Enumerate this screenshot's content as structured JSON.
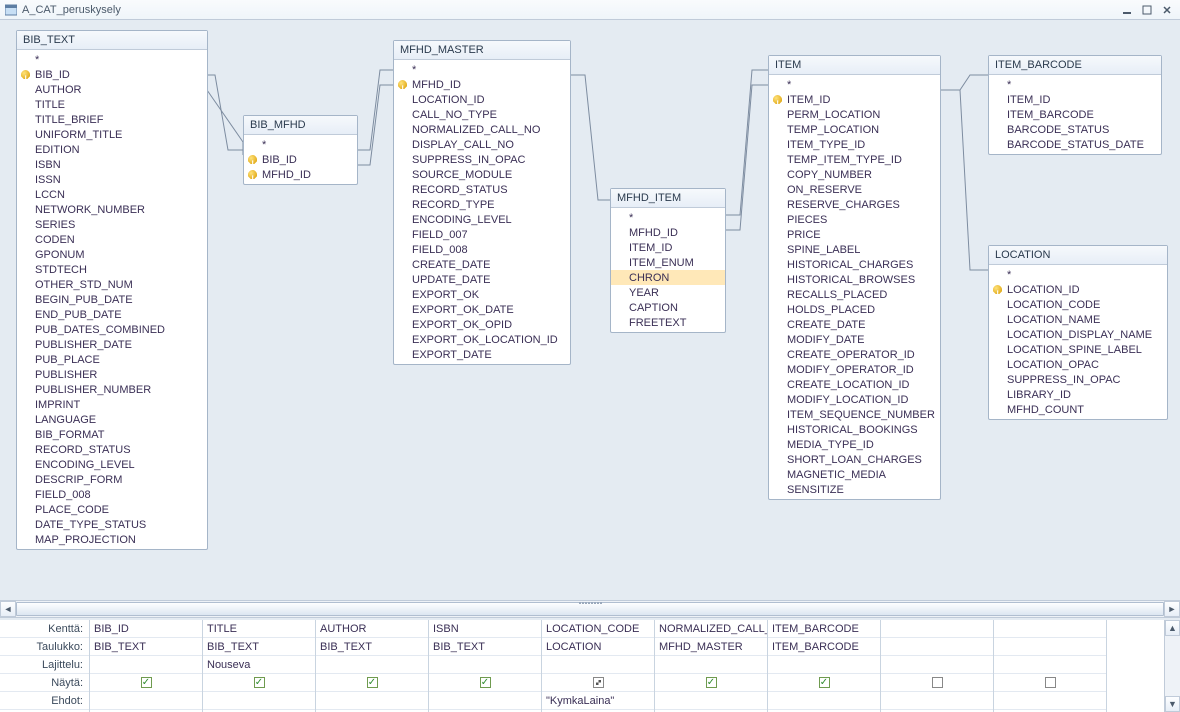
{
  "window": {
    "title": "A_CAT_peruskysely"
  },
  "tables": {
    "bib_text": {
      "title": "BIB_TEXT",
      "fields": [
        "*",
        "BIB_ID",
        "AUTHOR",
        "TITLE",
        "TITLE_BRIEF",
        "UNIFORM_TITLE",
        "EDITION",
        "ISBN",
        "ISSN",
        "LCCN",
        "NETWORK_NUMBER",
        "SERIES",
        "CODEN",
        "GPONUM",
        "STDTECH",
        "OTHER_STD_NUM",
        "BEGIN_PUB_DATE",
        "END_PUB_DATE",
        "PUB_DATES_COMBINED",
        "PUBLISHER_DATE",
        "PUB_PLACE",
        "PUBLISHER",
        "PUBLISHER_NUMBER",
        "IMPRINT",
        "LANGUAGE",
        "BIB_FORMAT",
        "RECORD_STATUS",
        "ENCODING_LEVEL",
        "DESCRIP_FORM",
        "FIELD_008",
        "PLACE_CODE",
        "DATE_TYPE_STATUS",
        "MAP_PROJECTION"
      ],
      "keys": [
        "BIB_ID"
      ]
    },
    "bib_mfhd": {
      "title": "BIB_MFHD",
      "fields": [
        "*",
        "BIB_ID",
        "MFHD_ID"
      ],
      "keys": [
        "BIB_ID",
        "MFHD_ID"
      ]
    },
    "mfhd_master": {
      "title": "MFHD_MASTER",
      "fields": [
        "*",
        "MFHD_ID",
        "LOCATION_ID",
        "CALL_NO_TYPE",
        "NORMALIZED_CALL_NO",
        "DISPLAY_CALL_NO",
        "SUPPRESS_IN_OPAC",
        "SOURCE_MODULE",
        "RECORD_STATUS",
        "RECORD_TYPE",
        "ENCODING_LEVEL",
        "FIELD_007",
        "FIELD_008",
        "CREATE_DATE",
        "UPDATE_DATE",
        "EXPORT_OK",
        "EXPORT_OK_DATE",
        "EXPORT_OK_OPID",
        "EXPORT_OK_LOCATION_ID",
        "EXPORT_DATE"
      ],
      "keys": [
        "MFHD_ID"
      ]
    },
    "mfhd_item": {
      "title": "MFHD_ITEM",
      "fields": [
        "*",
        "MFHD_ID",
        "ITEM_ID",
        "ITEM_ENUM",
        "CHRON",
        "YEAR",
        "CAPTION",
        "FREETEXT"
      ],
      "keys": [],
      "selected": "CHRON"
    },
    "item": {
      "title": "ITEM",
      "fields": [
        "*",
        "ITEM_ID",
        "PERM_LOCATION",
        "TEMP_LOCATION",
        "ITEM_TYPE_ID",
        "TEMP_ITEM_TYPE_ID",
        "COPY_NUMBER",
        "ON_RESERVE",
        "RESERVE_CHARGES",
        "PIECES",
        "PRICE",
        "SPINE_LABEL",
        "HISTORICAL_CHARGES",
        "HISTORICAL_BROWSES",
        "RECALLS_PLACED",
        "HOLDS_PLACED",
        "CREATE_DATE",
        "MODIFY_DATE",
        "CREATE_OPERATOR_ID",
        "MODIFY_OPERATOR_ID",
        "CREATE_LOCATION_ID",
        "MODIFY_LOCATION_ID",
        "ITEM_SEQUENCE_NUMBER",
        "HISTORICAL_BOOKINGS",
        "MEDIA_TYPE_ID",
        "SHORT_LOAN_CHARGES",
        "MAGNETIC_MEDIA",
        "SENSITIZE"
      ],
      "keys": [
        "ITEM_ID"
      ]
    },
    "item_barcode": {
      "title": "ITEM_BARCODE",
      "fields": [
        "*",
        "ITEM_ID",
        "ITEM_BARCODE",
        "BARCODE_STATUS",
        "BARCODE_STATUS_DATE"
      ],
      "keys": []
    },
    "location": {
      "title": "LOCATION",
      "fields": [
        "*",
        "LOCATION_ID",
        "LOCATION_CODE",
        "LOCATION_NAME",
        "LOCATION_DISPLAY_NAME",
        "LOCATION_SPINE_LABEL",
        "LOCATION_OPAC",
        "SUPPRESS_IN_OPAC",
        "LIBRARY_ID",
        "MFHD_COUNT"
      ],
      "keys": [
        "LOCATION_ID"
      ]
    }
  },
  "qbe": {
    "labels": {
      "field": "Kenttä:",
      "table": "Taulukko:",
      "sort": "Lajittelu:",
      "show": "Näytä:",
      "criteria": "Ehdot:"
    },
    "columns": [
      {
        "field": "BIB_ID",
        "table": "BIB_TEXT",
        "sort": "",
        "show": true,
        "criteria": ""
      },
      {
        "field": "TITLE",
        "table": "BIB_TEXT",
        "sort": "Nouseva",
        "show": true,
        "criteria": ""
      },
      {
        "field": "AUTHOR",
        "table": "BIB_TEXT",
        "sort": "",
        "show": true,
        "criteria": ""
      },
      {
        "field": "ISBN",
        "table": "BIB_TEXT",
        "sort": "",
        "show": true,
        "criteria": ""
      },
      {
        "field": "LOCATION_CODE",
        "table": "LOCATION",
        "sort": "",
        "show": "dot",
        "criteria": "\"KymkaLaina\""
      },
      {
        "field": "NORMALIZED_CALL_",
        "table": "MFHD_MASTER",
        "sort": "",
        "show": true,
        "criteria": ""
      },
      {
        "field": "ITEM_BARCODE",
        "table": "ITEM_BARCODE",
        "sort": "",
        "show": true,
        "criteria": ""
      },
      {
        "field": "",
        "table": "",
        "sort": "",
        "show": false,
        "criteria": ""
      },
      {
        "field": "",
        "table": "",
        "sort": "",
        "show": false,
        "criteria": ""
      }
    ]
  }
}
